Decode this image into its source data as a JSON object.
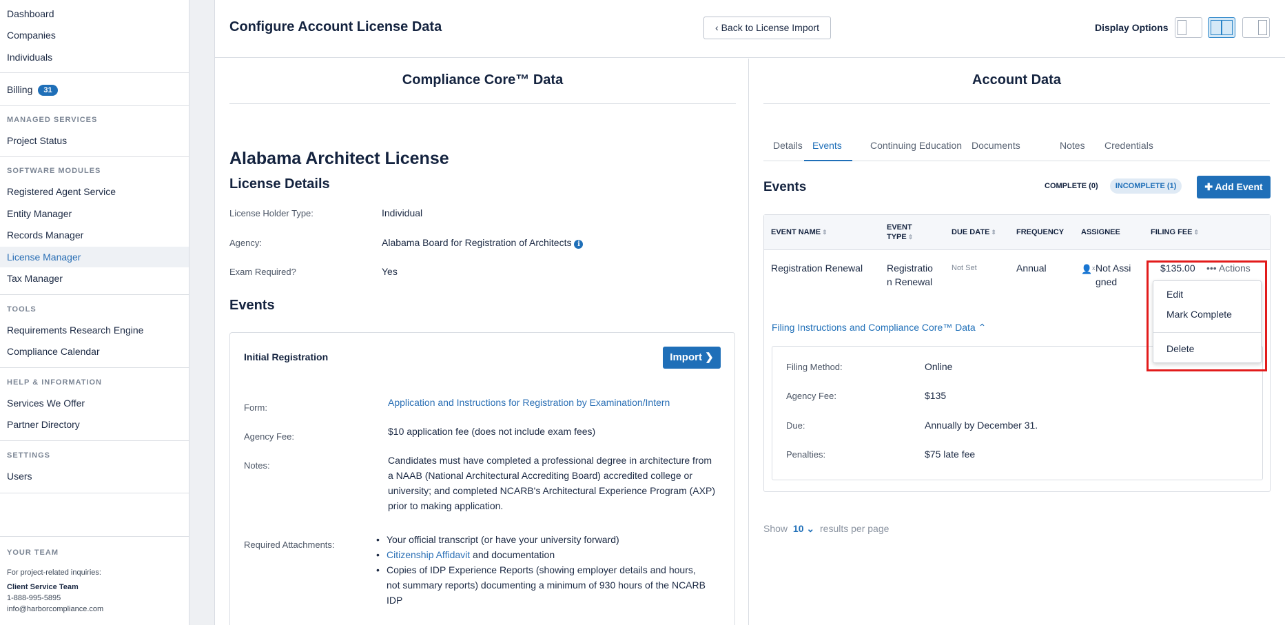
{
  "sidebar": {
    "top_links": [
      "Dashboard",
      "Companies",
      "Individuals"
    ],
    "billing": {
      "label": "Billing",
      "badge": "31"
    },
    "managed_services": {
      "heading": "MANAGED SERVICES",
      "items": [
        "Project Status"
      ]
    },
    "software_modules": {
      "heading": "SOFTWARE MODULES",
      "items": [
        "Registered Agent Service",
        "Entity Manager",
        "Records Manager",
        "License Manager",
        "Tax Manager"
      ],
      "active": "License Manager"
    },
    "tools": {
      "heading": "TOOLS",
      "items": [
        "Requirements Research Engine",
        "Compliance Calendar"
      ]
    },
    "help": {
      "heading": "HELP & INFORMATION",
      "items": [
        "Services We Offer",
        "Partner Directory"
      ]
    },
    "settings": {
      "heading": "SETTINGS",
      "items": [
        "Users"
      ]
    },
    "team": {
      "heading": "YOUR TEAM",
      "note": "For project-related inquiries:",
      "name": "Client Service Team",
      "phone": "1-888-995-5895",
      "email": "info@harborcompliance.com"
    }
  },
  "header": {
    "title": "Configure Account License Data",
    "back_button": "‹ Back to License Import",
    "display_options_label": "Display Options",
    "display_modes": [
      "single-pane",
      "split-pane",
      "wide-right-pane"
    ],
    "active_display_mode": "split-pane"
  },
  "left": {
    "column_title": "Compliance Core™ Data",
    "license_name": "Alabama Architect License",
    "details_heading": "License Details",
    "details": [
      {
        "label": "License Holder Type:",
        "value": "Individual"
      },
      {
        "label": "Agency:",
        "value": "Alabama Board for Registration of Architects"
      },
      {
        "label": "Exam Required?",
        "value": "Yes"
      }
    ],
    "events_heading": "Events",
    "event_card": {
      "title": "Initial Registration",
      "import_button": "Import",
      "form_label": "Form:",
      "form_link": "Application and Instructions for Registration by Examination/Intern",
      "fee_label": "Agency Fee:",
      "fee_value": "$10 application fee (does not include exam fees)",
      "notes_label": "Notes:",
      "notes_value": "Candidates must have completed a professional degree in architecture from a NAAB (National Architectural Accrediting Board) accredited college or university; and completed NCARB's Architectural Experience Program (AXP) prior to making application.",
      "attachments_label": "Required Attachments:",
      "attachments": {
        "item1": "Your official transcript (or have your university forward)",
        "item2_link": "Citizenship Affidavit",
        "item2_rest": " and documentation",
        "item3": "Copies of IDP Experience Reports (showing employer details and hours, not summary reports) documenting a minimum of 930 hours of the NCARB IDP"
      }
    }
  },
  "right": {
    "column_title": "Account Data",
    "tabs": [
      "Details",
      "Events",
      "Continuing Education",
      "Documents",
      "Notes",
      "Credentials"
    ],
    "active_tab": "Events",
    "events_heading": "Events",
    "filter_complete": "COMPLETE (0)",
    "filter_incomplete": "INCOMPLETE (1)",
    "add_event_button": "Add Event",
    "table": {
      "columns": [
        "EVENT NAME",
        "EVENT TYPE",
        "DUE DATE",
        "FREQUENCY",
        "ASSIGNEE",
        "FILING FEE"
      ],
      "row": {
        "event_name": "Registration Renewal",
        "event_type": "Registration Renewal",
        "due_date": "Not Set",
        "frequency": "Annual",
        "assignee": "Not Assigned",
        "filing_fee": "$135.00",
        "actions": "Actions"
      }
    },
    "filing_toggle": "Filing Instructions and Compliance Core™ Data",
    "filing_details": [
      {
        "label": "Filing Method:",
        "value": "Online"
      },
      {
        "label": "Agency Fee:",
        "value": "$135"
      },
      {
        "label": "Due:",
        "value": "Annually by December 31."
      },
      {
        "label": "Penalties:",
        "value": "$75 late fee"
      }
    ],
    "pagination": {
      "prefix": "Show",
      "value": "10",
      "suffix": "results per page"
    }
  },
  "actions_menu": {
    "items": [
      "Edit",
      "Mark Complete",
      "Delete"
    ]
  },
  "colors": {
    "accent": "#1f6fb8",
    "highlight": "#e21b1b",
    "title": "#14233f"
  }
}
